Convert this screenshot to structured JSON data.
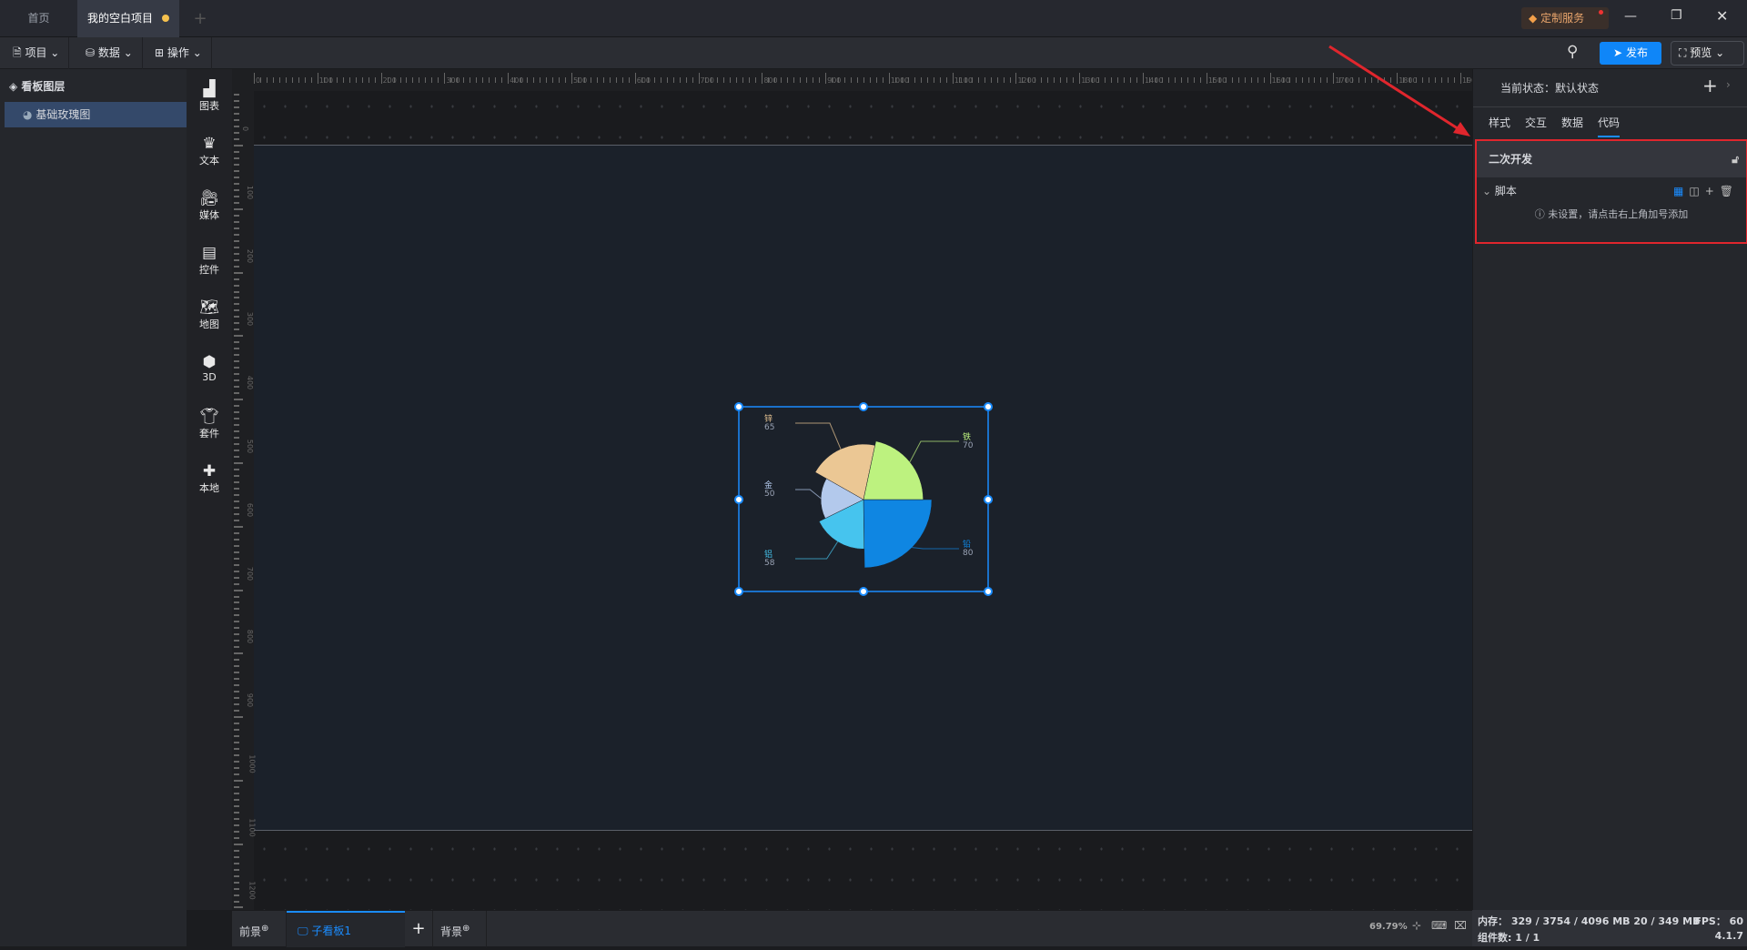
{
  "titlebar": {
    "tabs": [
      {
        "label": "首页"
      },
      {
        "label": "我的空白项目"
      }
    ],
    "add_tab": "+",
    "custom_service": "定制服务"
  },
  "toolbar": {
    "menus": [
      {
        "label": "项目"
      },
      {
        "label": "数据"
      },
      {
        "label": "操作"
      }
    ],
    "publish": "发布",
    "preview": "预览"
  },
  "layers": {
    "title": "看板图层",
    "items": [
      {
        "label": "基础玫瑰图"
      }
    ]
  },
  "sidebar": {
    "items": [
      {
        "label": "图表",
        "icon": "chart-icon"
      },
      {
        "label": "文本",
        "icon": "text-icon"
      },
      {
        "label": "媒体",
        "icon": "media-icon"
      },
      {
        "label": "控件",
        "icon": "control-icon"
      },
      {
        "label": "地图",
        "icon": "map-icon"
      },
      {
        "label": "3D",
        "icon": "cube-icon"
      },
      {
        "label": "套件",
        "icon": "suit-icon"
      },
      {
        "label": "本地",
        "icon": "puzzle-icon"
      }
    ]
  },
  "right_panel": {
    "state_label": "当前状态：",
    "state_value": "默认状态",
    "tabs": [
      {
        "label": "样式"
      },
      {
        "label": "交互"
      },
      {
        "label": "数据"
      },
      {
        "label": "代码"
      }
    ],
    "active_tab": "代码",
    "section_title": "二次开发",
    "script_label": "脚本",
    "empty_hint": "未设置，请点击右上角加号添加"
  },
  "bottom": {
    "foreground": "前景",
    "board": "子看板1",
    "background": "背景",
    "zoom": "69.79%"
  },
  "status": {
    "memory": "内存： 329 / 3754 / 4096 MB  20 / 349 MB",
    "fps": "FPS： 60",
    "components": "组件数: 1 / 1",
    "version": "4.1.7"
  },
  "colors": {
    "accent": "#1a8cff",
    "highlight": "#e0262d"
  },
  "chart_data": {
    "type": "pie",
    "rose_type": "radius",
    "categories": [
      "铅",
      "铝",
      "金",
      "锌",
      "铁"
    ],
    "values": [
      80,
      58,
      50,
      65,
      70
    ],
    "colors": [
      "#0f86e2",
      "#46c4ee",
      "#b3c9ec",
      "#ebc794",
      "#bdf27f"
    ]
  }
}
